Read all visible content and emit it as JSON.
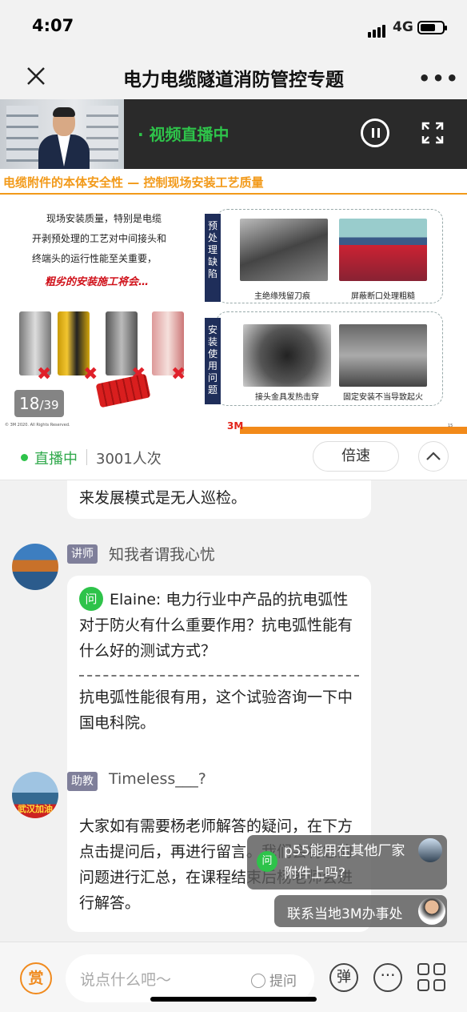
{
  "status_bar": {
    "time": "4:07",
    "network": "4G"
  },
  "nav": {
    "title": "电力电缆隧道消防管控专题"
  },
  "video": {
    "live_label": "· 视频直播中",
    "slide": {
      "title": "电缆附件的本体安全性 — 控制现场安装工艺质量",
      "text_lines": [
        "现场安装质量，特别是电缆",
        "开剥预处理的工艺对中间接头和",
        "终端头的运行性能至关重要，"
      ],
      "warning": "粗劣的安装施工将会…",
      "section1": "预处理缺陷",
      "section2": "安装使用问题",
      "captions": [
        "主绝缘残留刀痕",
        "屏蔽断口处理粗糙",
        "接头金具发热击穿",
        "固定安装不当导致起火"
      ],
      "copyright": "© 3M 2020. All Rights Reserved.",
      "brand": "3M",
      "slide_number": "15",
      "page_current": "18",
      "page_total": "/39"
    }
  },
  "live_bar": {
    "status": "直播中",
    "viewer_count": "3001人次",
    "speed_button": "倍速"
  },
  "chat": {
    "partial_message": "来发展模式是无人巡检。",
    "messages": [
      {
        "role": "讲师",
        "name": "知我者谓我心忧",
        "question_badge": "问",
        "question": "Elaine: 电力行业中产品的抗电弧性对于防火有什么重要作用？抗电弧性能有什么好的测试方式？",
        "answer": "抗电弧性能很有用，这个试验咨询一下中国电科院。"
      },
      {
        "role": "助教",
        "name": "Timeless___?",
        "avatar_text": "武汉加油",
        "text": "大家如有需要杨老师解答的疑问，在下方点击提问后，再进行留言。我们会将您的问题进行汇总，在课程结束后杨老师会进行解答。"
      }
    ]
  },
  "toasts": [
    {
      "badge": "问",
      "text": "p55能用在其他厂家附件上吗?"
    },
    {
      "text": "联系当地3M办事处"
    }
  ],
  "bottom_bar": {
    "reward_label": "赏",
    "input_placeholder": "说点什么吧～",
    "ask_label": "提问",
    "danmu_label": "弹"
  },
  "colors": {
    "accent_green": "#2ec34a",
    "slide_orange": "#f29a1a",
    "reward_orange": "#f08a1e"
  }
}
